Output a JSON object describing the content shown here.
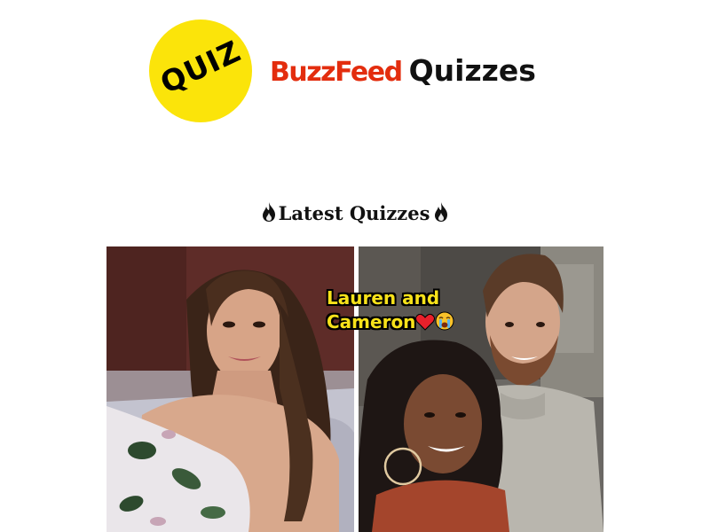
{
  "header": {
    "badge_text": "QUIZ",
    "brand_name": "BuzzFeed",
    "brand_suffix": "Quizzes",
    "badge_color": "#fbe40a",
    "brand_color": "#e32d0e"
  },
  "section": {
    "title": "Latest Quizzes",
    "icon": "fire-icon"
  },
  "quiz_card": {
    "caption_line1": "Lauren and",
    "caption_line2": "Cameron",
    "caption_emojis": [
      "red-heart-icon",
      "crying-face-icon"
    ],
    "caption_color": "#f7e21a"
  }
}
